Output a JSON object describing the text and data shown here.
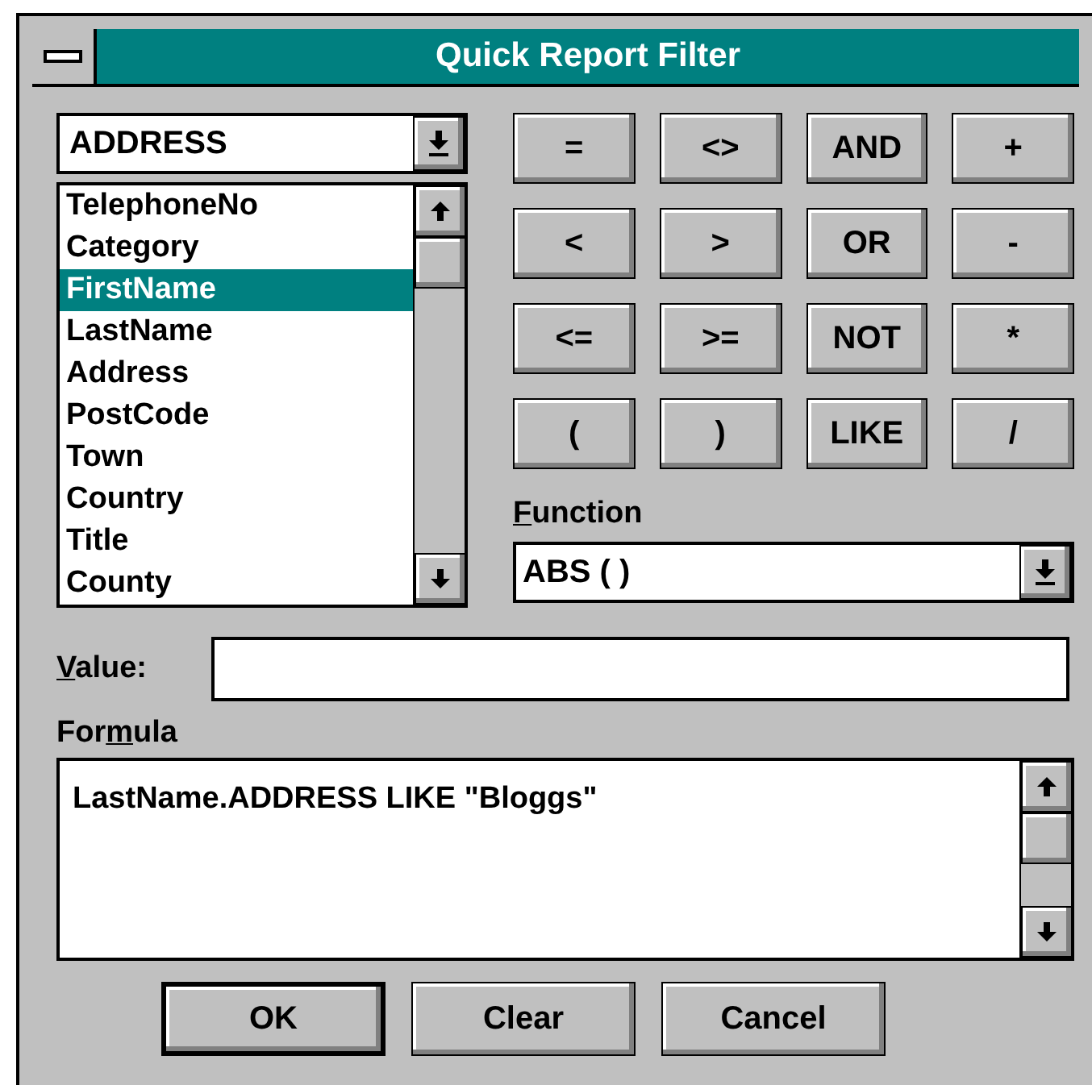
{
  "window": {
    "title": "Quick Report Filter"
  },
  "table_combo": {
    "value": "ADDRESS"
  },
  "fields": [
    {
      "label": "TelephoneNo",
      "selected": false
    },
    {
      "label": "Category",
      "selected": false
    },
    {
      "label": "FirstName",
      "selected": true
    },
    {
      "label": "LastName",
      "selected": false
    },
    {
      "label": "Address",
      "selected": false
    },
    {
      "label": "PostCode",
      "selected": false
    },
    {
      "label": "Town",
      "selected": false
    },
    {
      "label": "Country",
      "selected": false
    },
    {
      "label": "Title",
      "selected": false
    },
    {
      "label": "County",
      "selected": false
    }
  ],
  "operators": [
    "=",
    "<>",
    "AND",
    "+",
    "<",
    ">",
    "OR",
    "-",
    "<=",
    ">=",
    "NOT",
    "*",
    "(",
    ")",
    "LIKE",
    "/"
  ],
  "function": {
    "label": {
      "key": "F",
      "after": "unction"
    },
    "value": "ABS ( )"
  },
  "value_field": {
    "label": {
      "key": "V",
      "after": "alue:"
    }
  },
  "formula": {
    "label": {
      "before": "For",
      "key": "m",
      "after": "ula"
    },
    "text": "LastName.ADDRESS LIKE \"Bloggs\""
  },
  "buttons": [
    {
      "label": "OK",
      "default": true
    },
    {
      "label": "Clear",
      "default": false
    },
    {
      "label": "Cancel",
      "default": false
    }
  ]
}
